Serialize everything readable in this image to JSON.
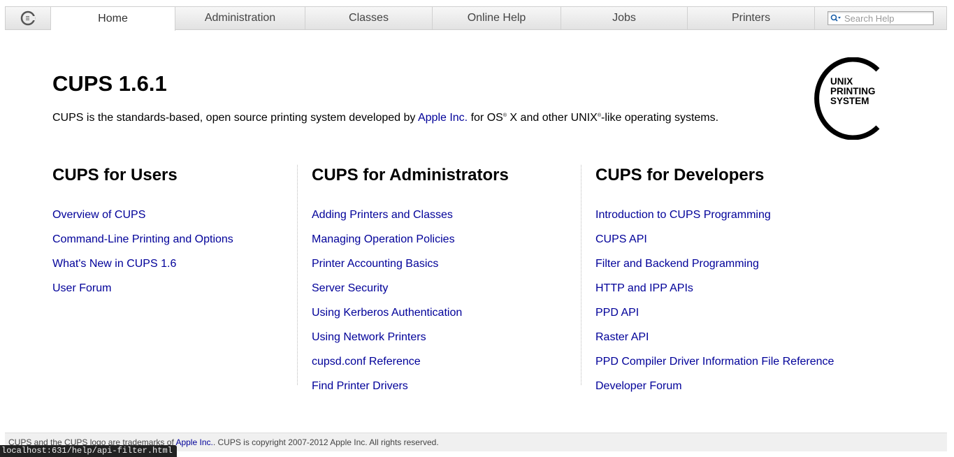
{
  "nav": {
    "tabs": [
      {
        "label": "Home",
        "active": true
      },
      {
        "label": "Administration"
      },
      {
        "label": "Classes"
      },
      {
        "label": "Online Help"
      },
      {
        "label": "Jobs"
      },
      {
        "label": "Printers"
      }
    ],
    "search_placeholder": "Search Help"
  },
  "header": {
    "title": "CUPS 1.6.1",
    "intro_before": "CUPS is the standards-based, open source printing system developed by ",
    "intro_link": "Apple Inc.",
    "intro_mid1": " for OS",
    "reg1": "®",
    "intro_mid2": " X and other UNIX",
    "reg2": "®",
    "intro_after": "-like operating systems."
  },
  "logo": {
    "line1": "UNIX",
    "line2": "PRINTING",
    "line3": "SYSTEM"
  },
  "columns": {
    "users": {
      "heading": "CUPS for Users",
      "links": [
        "Overview of CUPS",
        "Command-Line Printing and Options",
        "What's New in CUPS 1.6",
        "User Forum"
      ]
    },
    "admin": {
      "heading": "CUPS for Administrators",
      "links": [
        "Adding Printers and Classes",
        "Managing Operation Policies",
        "Printer Accounting Basics",
        "Server Security",
        "Using Kerberos Authentication",
        "Using Network Printers",
        "cupsd.conf Reference",
        "Find Printer Drivers"
      ]
    },
    "dev": {
      "heading": "CUPS for Developers",
      "links": [
        "Introduction to CUPS Programming",
        "CUPS API",
        "Filter and Backend Programming",
        "HTTP and IPP APIs",
        "PPD API",
        "Raster API",
        "PPD Compiler Driver Information File Reference",
        "Developer Forum"
      ]
    }
  },
  "footer": {
    "before": "CUPS and the CUPS logo are trademarks of ",
    "link": "Apple Inc.",
    "after": ". CUPS is copyright 2007-2012 Apple Inc. All rights reserved."
  },
  "statusbar": "localhost:631/help/api-filter.html",
  "colors": {
    "link": "#000099",
    "nav_bg": "#e9e9e9",
    "footer_bg": "#f0f0f0"
  }
}
